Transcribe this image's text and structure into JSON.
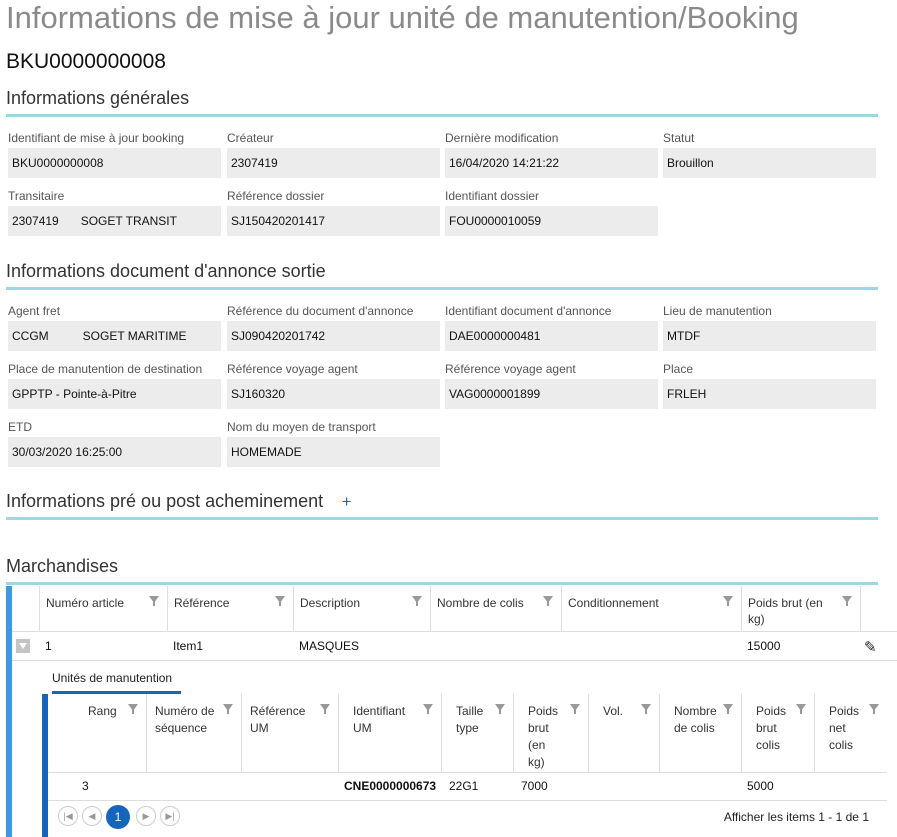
{
  "page_title": "Informations de mise à jour unité de manutention/Booking",
  "booking_id": "BKU0000000008",
  "sections": {
    "general": {
      "title": "Informations générales",
      "fields": [
        {
          "label": "Identifiant de mise à jour booking",
          "value": "BKU0000000008"
        },
        {
          "label": "Créateur",
          "value": "2307419"
        },
        {
          "label": "Dernière modification",
          "value": "16/04/2020 14:21:22"
        },
        {
          "label": "Statut",
          "value": "Brouillon"
        },
        {
          "label": "Transitaire",
          "value_code": "2307419",
          "value_name": "SOGET TRANSIT"
        },
        {
          "label": "Référence dossier",
          "value": "SJ150420201417"
        },
        {
          "label": "Identifiant dossier",
          "value": "FOU0000010059"
        }
      ]
    },
    "annonce": {
      "title": "Informations document d'annonce sortie",
      "fields": [
        {
          "label": "Agent fret",
          "value_code": "CCGM",
          "value_name": "SOGET MARITIME"
        },
        {
          "label": "Référence du document d'annonce",
          "value": "SJ090420201742"
        },
        {
          "label": "Identifiant document d'annonce",
          "value": "DAE0000000481"
        },
        {
          "label": "Lieu de manutention",
          "value": "MTDF"
        },
        {
          "label": "Place de manutention de destination",
          "value": "GPPTP - Pointe-à-Pitre"
        },
        {
          "label": "Référence voyage agent",
          "value": "SJ160320"
        },
        {
          "label": "Référence voyage agent",
          "value": "VAG0000001899"
        },
        {
          "label": "Place",
          "value": "FRLEH"
        },
        {
          "label": "ETD",
          "value": "30/03/2020 16:25:00"
        },
        {
          "label": "Nom du moyen de transport",
          "value": "HOMEMADE"
        }
      ]
    },
    "acheminement": {
      "title": "Informations pré ou post acheminement",
      "add_label": "+"
    },
    "marchandises": {
      "title": "Marchandises",
      "columns": [
        "Numéro article",
        "Référence",
        "Description",
        "Nombre de colis",
        "Conditionnement",
        "Poids brut (en kg)"
      ],
      "rows": [
        {
          "numero": "1",
          "reference": "Item1",
          "description": "MASQUES",
          "nombre_colis": "",
          "conditionnement": "",
          "poids_brut": "15000"
        }
      ],
      "sub": {
        "title": "Unités de manutention",
        "columns": [
          "Rang",
          "Numéro de séquence",
          "Référence UM",
          "Identifiant UM",
          "Taille type",
          "Poids brut (en kg)",
          "Vol.",
          "Nombre de colis",
          "Poids brut colis",
          "Poids net colis"
        ],
        "rows": [
          {
            "rang": "3",
            "sequence": "",
            "ref_um": "",
            "id_um": "CNE0000000673",
            "taille": "22G1",
            "poids_brut": "7000",
            "vol": "",
            "nb_colis": "",
            "poids_brut_colis": "5000",
            "poids_net_colis": ""
          }
        ],
        "pager": {
          "first_icon": "first-page-icon",
          "prev_icon": "previous-page-icon",
          "current_page": "1",
          "next_icon": "next-page-icon",
          "last_icon": "last-page-icon",
          "info": "Afficher les items 1 - 1 de 1"
        }
      }
    }
  },
  "colors": {
    "accent_line": "#9fd6e4",
    "primary": "#1565c0",
    "grid_accent": "#3b9ae6",
    "field_bg": "#ececec"
  }
}
